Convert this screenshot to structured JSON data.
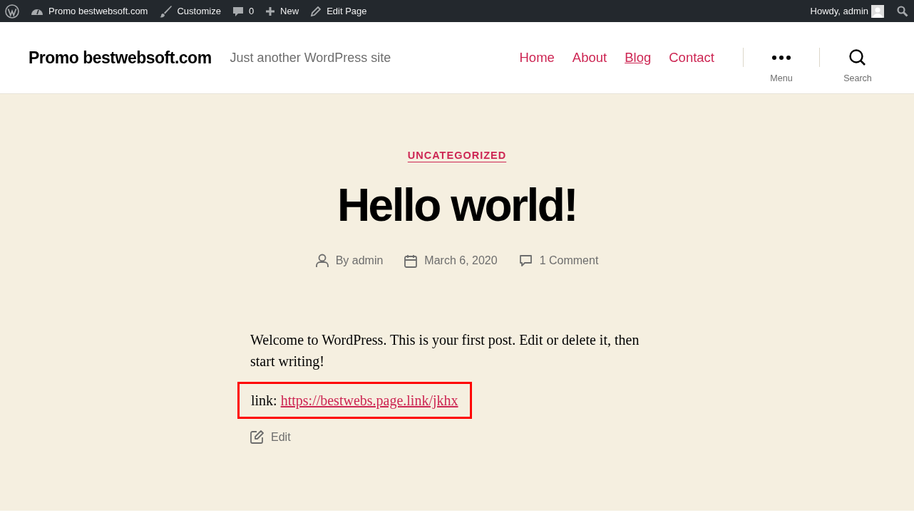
{
  "admin_bar": {
    "items": [
      {
        "kind": "logo"
      },
      {
        "kind": "site",
        "label": "Promo bestwebsoft.com"
      },
      {
        "kind": "customize",
        "label": "Customize"
      },
      {
        "kind": "comments",
        "label": "0"
      },
      {
        "kind": "new",
        "label": "New"
      },
      {
        "kind": "edit",
        "label": "Edit Page"
      }
    ],
    "greeting": "Howdy, admin"
  },
  "header": {
    "site_title": "Promo bestwebsoft.com",
    "tagline": "Just another WordPress site",
    "nav": [
      {
        "label": "Home",
        "selected": false
      },
      {
        "label": "About",
        "selected": false
      },
      {
        "label": "Blog",
        "selected": true
      },
      {
        "label": "Contact",
        "selected": false
      }
    ],
    "toggles": [
      {
        "kind": "menu",
        "label": "Menu"
      },
      {
        "kind": "search",
        "label": "Search"
      }
    ]
  },
  "post": {
    "category": "UNCATEGORIZED",
    "title": "Hello world!",
    "meta": [
      {
        "kind": "author",
        "label": "By admin"
      },
      {
        "kind": "date",
        "label": "March 6, 2020"
      },
      {
        "kind": "comments",
        "label": "1 Comment"
      }
    ],
    "paragraphs": [
      "Welcome to WordPress. This is your first post. Edit or delete it, then start writing!"
    ],
    "link_line": {
      "prefix": "link:",
      "url": "https://bestwebs.page.link/jkhx",
      "highlighted": true
    },
    "edit_label": "Edit"
  }
}
